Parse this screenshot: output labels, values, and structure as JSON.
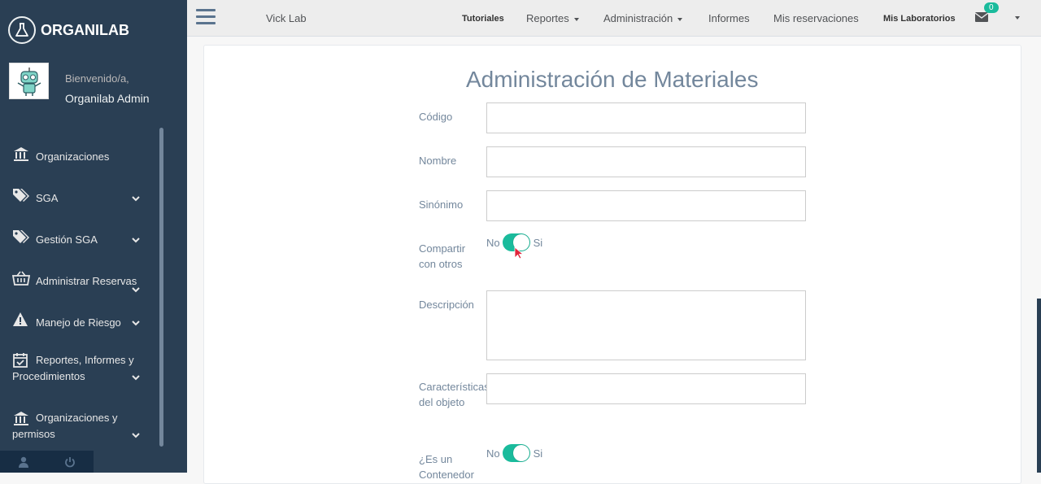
{
  "brand": {
    "name": "ORGANILAB"
  },
  "profile": {
    "welcome": "Bienvenido/a,",
    "username": "Organilab Admin"
  },
  "sidebar": {
    "items": [
      {
        "label": "Organizaciones"
      },
      {
        "label": "SGA"
      },
      {
        "label": "Gestión SGA"
      },
      {
        "label": "Administrar Reservas"
      },
      {
        "label": "Manejo de Riesgo"
      },
      {
        "label": "Reportes, Informes y Procedimientos"
      },
      {
        "label": "Organizaciones y permisos"
      }
    ]
  },
  "topnav": {
    "lab": "Vick Lab",
    "tutoriales": "Tutoriales",
    "reportes": "Reportes",
    "administracion": "Administración",
    "informes": "Informes",
    "reservaciones": "Mis reservaciones",
    "laboratorios": "Mis Laboratorios",
    "notification_count": "0"
  },
  "form": {
    "title": "Administración de Materiales",
    "codigo_label": "Código",
    "nombre_label": "Nombre",
    "sinonimo_label": "Sinónimo",
    "compartir_label": "Compartir con otros",
    "descripcion_label": "Descripción",
    "caracteristicas_label": "Características del objeto",
    "contenedor_label": "¿Es un Contenedor",
    "toggle_no": "No",
    "toggle_si": "Si",
    "codigo_value": "",
    "nombre_value": "",
    "sinonimo_value": "",
    "descripcion_value": "",
    "caracteristicas_value": ""
  },
  "colors": {
    "sidebar": "#2a3f54",
    "accent": "#1abb9c",
    "text_muted": "#73879c"
  }
}
